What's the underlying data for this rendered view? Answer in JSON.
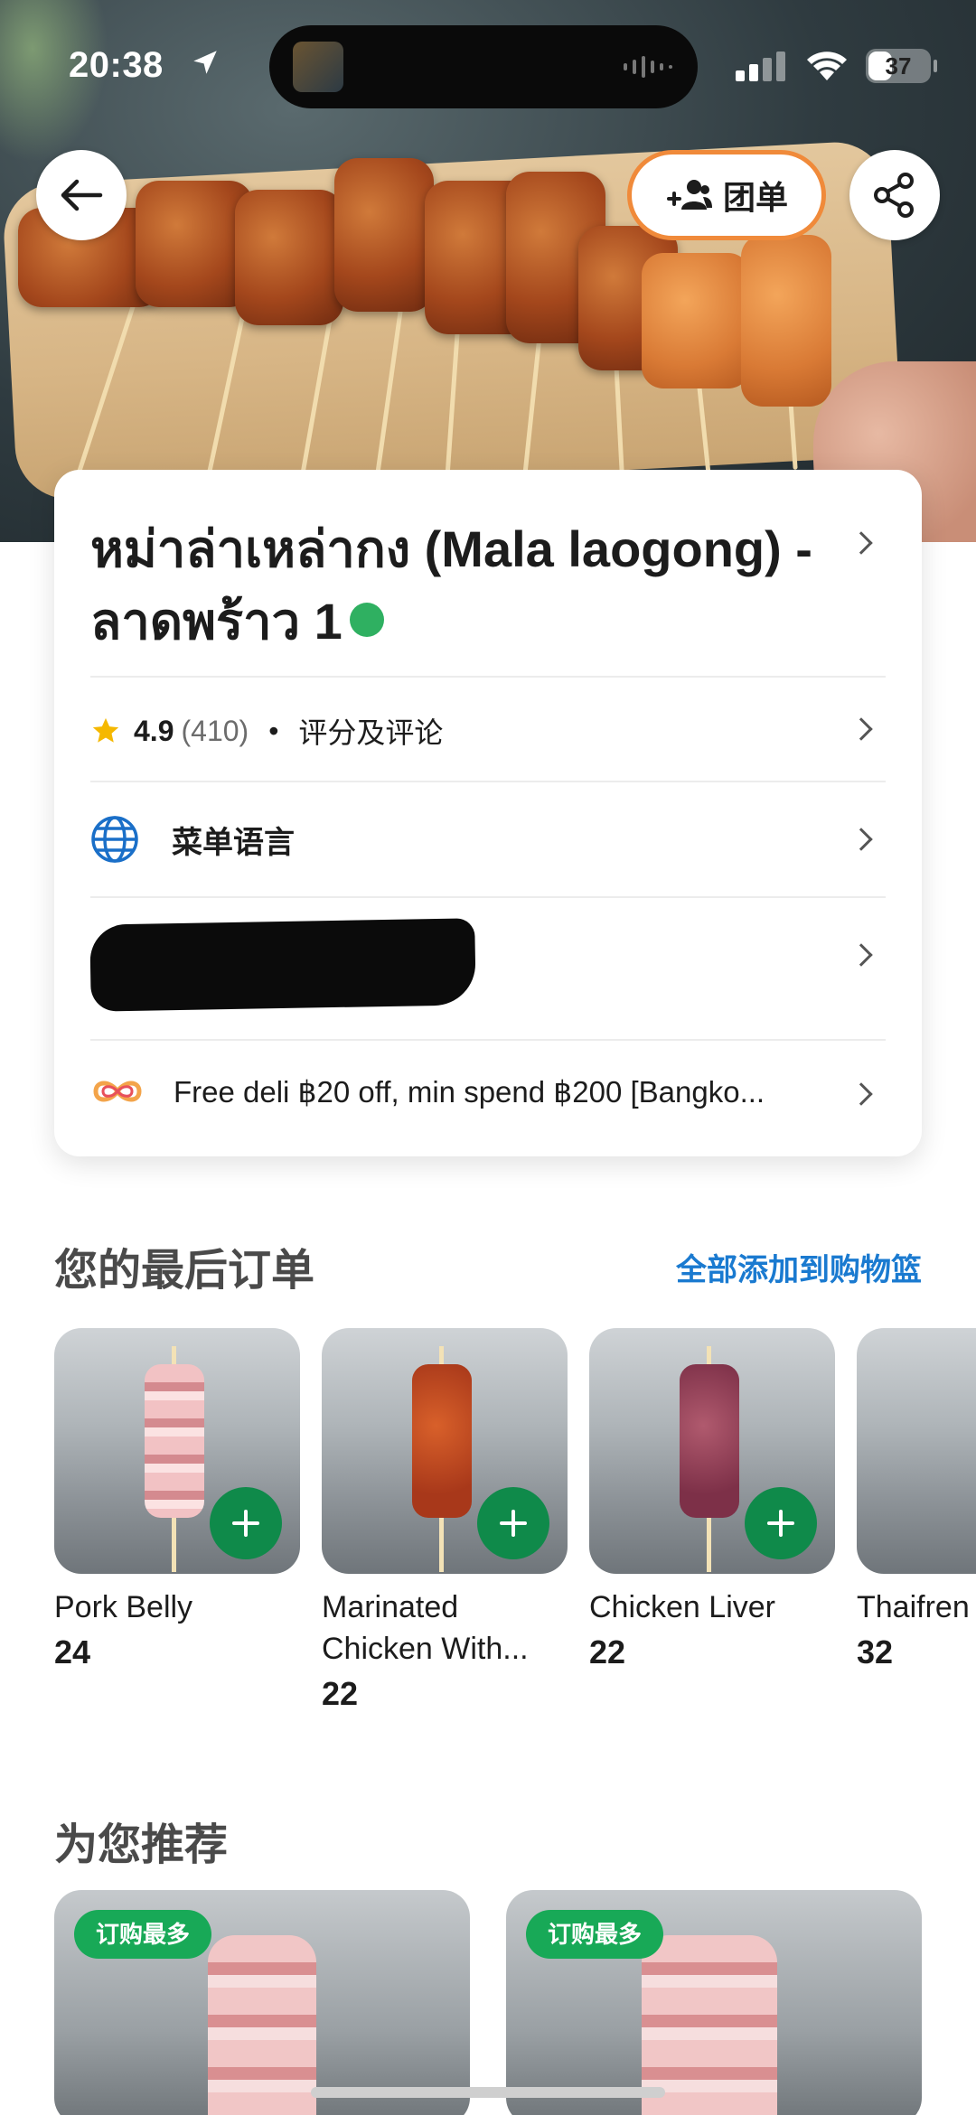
{
  "status_bar": {
    "time": "20:38",
    "battery": "37"
  },
  "header": {
    "group_order_label": "团单"
  },
  "store": {
    "name": "หม่าล่าเหล่ากง (Mala laogong) - ลาดพร้าว 1",
    "rating": "4.9",
    "rating_count": "(410)",
    "rating_link": "评分及评论",
    "menu_language": "菜单语言",
    "promo": "Free deli ฿20 off, min spend ฿200 [Bangko..."
  },
  "last_order": {
    "title": "您的最后订单",
    "add_all": "全部添加到购物篮",
    "items": [
      {
        "name": "Pork Belly",
        "price": "24"
      },
      {
        "name": "Marinated Chicken With...",
        "price": "22"
      },
      {
        "name": "Chicken Liver",
        "price": "22"
      },
      {
        "name": "Thaifren",
        "price": "32"
      }
    ]
  },
  "recommended": {
    "title": "为您推荐",
    "badge": "订购最多"
  },
  "colors": {
    "brand_green": "#0f8a4a",
    "link_blue": "#1a7ad0",
    "accent_orange": "#f08a3a"
  }
}
